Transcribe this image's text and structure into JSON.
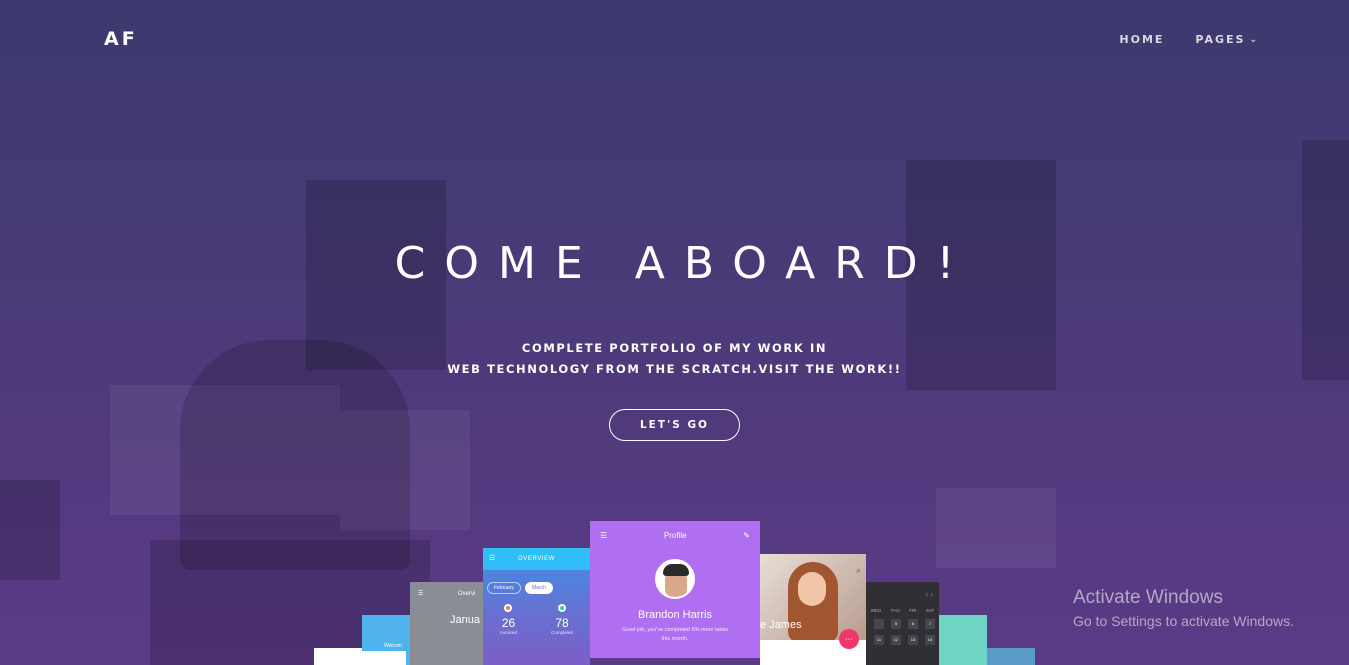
{
  "nav": {
    "logo": "AF",
    "links": [
      {
        "label": "HOME"
      },
      {
        "label": "PAGES"
      }
    ]
  },
  "hero": {
    "title": "COME ABOARD!",
    "subtitle_line1": "COMPLETE PORTFOLIO OF MY WORK IN",
    "subtitle_line2": "WEB TECHNOLOGY FROM THE SCRATCH.VISIT THE WORK!!",
    "cta_label": "LET'S GO"
  },
  "mockups": {
    "overview": {
      "title": "OVERVIEW",
      "pills": [
        "February",
        "March"
      ],
      "stats": [
        {
          "value": "26",
          "label": "Invoiced"
        },
        {
          "value": "78",
          "label": "Completed"
        }
      ]
    },
    "grey_card": {
      "title": "Overvi",
      "text": "Janua"
    },
    "blue_card": {
      "text": "Welcom"
    },
    "profile": {
      "header": "Profile",
      "name": "Brandon Harris",
      "description": "Good job, you've completed 6% more tasks this month."
    },
    "photo": {
      "name": "e James"
    },
    "calendar": {
      "days": [
        "WED",
        "THU",
        "FRI",
        "SAT"
      ],
      "cells": [
        "11",
        "12",
        "13",
        "14",
        "",
        "5",
        "6",
        "7"
      ]
    }
  },
  "watermark": {
    "title": "Activate Windows",
    "subtitle": "Go to Settings to activate Windows."
  }
}
